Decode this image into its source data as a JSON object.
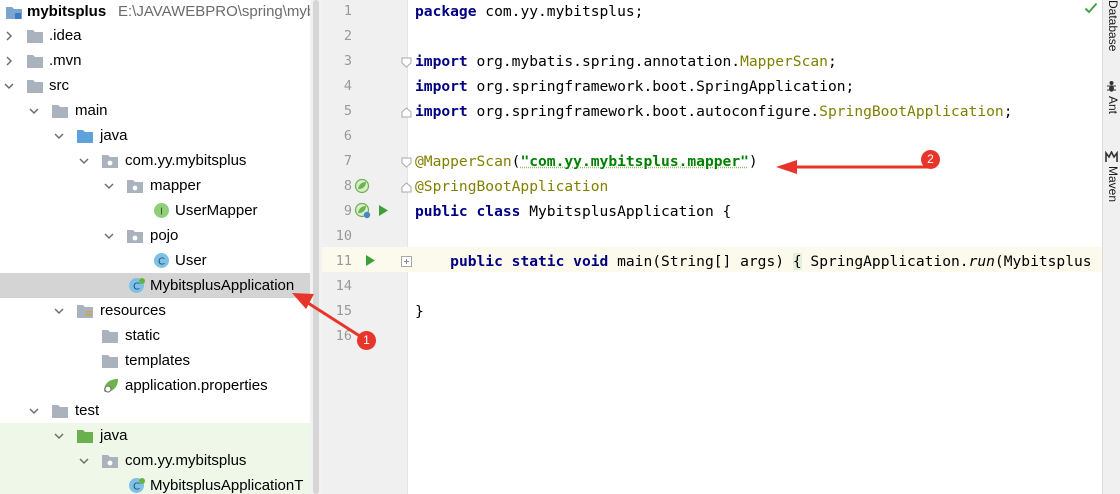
{
  "project_tree": {
    "root": {
      "name": "mybitsplus",
      "path": "E:\\JAVAWEBPRO\\spring\\mybt"
    },
    "items": [
      {
        "label": ".idea"
      },
      {
        "label": ".mvn"
      },
      {
        "label": "src"
      },
      {
        "label": "main"
      },
      {
        "label": "java"
      },
      {
        "label": "com.yy.mybitsplus"
      },
      {
        "label": "mapper"
      },
      {
        "label": "UserMapper"
      },
      {
        "label": "pojo"
      },
      {
        "label": "User"
      },
      {
        "label": "MybitsplusApplication"
      },
      {
        "label": "resources"
      },
      {
        "label": "static"
      },
      {
        "label": "templates"
      },
      {
        "label": "application.properties"
      },
      {
        "label": "test"
      },
      {
        "label": "java"
      },
      {
        "label": "com.yy.mybitsplus"
      },
      {
        "label": "MybitsplusApplicationT"
      }
    ],
    "icon_letters": {
      "interface": "I",
      "class": "C"
    }
  },
  "editor": {
    "line_numbers": [
      "1",
      "2",
      "3",
      "4",
      "5",
      "6",
      "7",
      "8",
      "9",
      "10",
      "11",
      "14",
      "15",
      "16"
    ],
    "code": {
      "l1": {
        "kw": "package",
        "rest": " com.yy.mybitsplus;"
      },
      "l3": {
        "kw": "import",
        "pre": " org.mybatis.spring.annotation.",
        "ann": "MapperScan",
        "post": ";"
      },
      "l4": {
        "kw": "import",
        "rest": " org.springframework.boot.SpringApplication;"
      },
      "l5": {
        "kw": "import",
        "pre": " org.springframework.boot.autoconfigure.",
        "ann": "SpringBootApplication",
        "post": ";"
      },
      "l7": {
        "ann": "@MapperScan",
        "open": "(",
        "str": "\"com.yy.mybitsplus.mapper\"",
        "close": ")"
      },
      "l8": {
        "ann": "@SpringBootApplication"
      },
      "l9": {
        "kw": "public class",
        "rest": " MybitsplusApplication {"
      },
      "l11": {
        "indent": "    ",
        "kw": "public static void",
        "pre": " main(String[] args) ",
        "brace": "{",
        "mid": " SpringApplication.",
        "it": "run",
        "post": "(Mybitsplus"
      },
      "l15": {
        "rest": "}"
      }
    }
  },
  "tool_windows": {
    "right": [
      "Database",
      "Ant",
      "Maven"
    ]
  },
  "annotations": {
    "badge1": "1",
    "badge2": "2"
  },
  "colors": {
    "keyword": "#000080",
    "annotation": "#808000",
    "string": "#008000",
    "arrow": "#e8352b",
    "selection": "#d4d4d4",
    "test_bg": "#eff7e8"
  }
}
